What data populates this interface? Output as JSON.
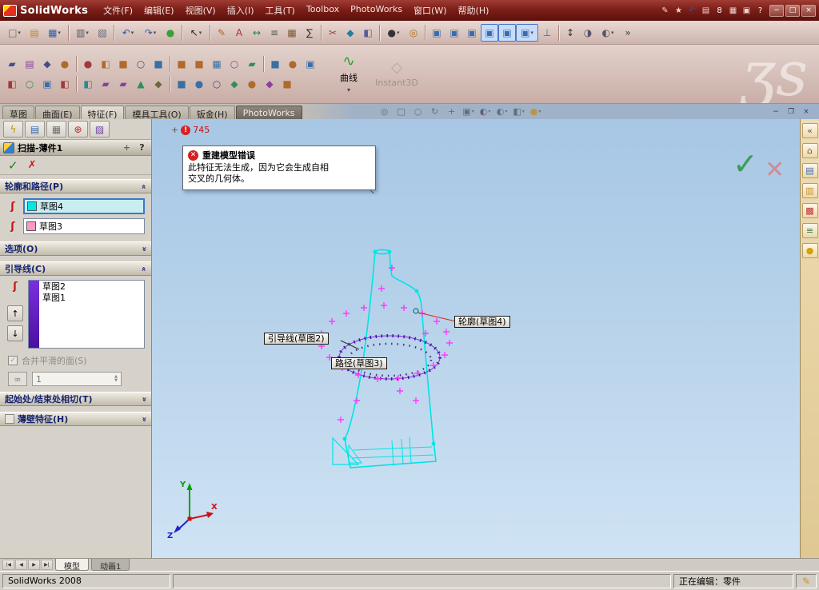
{
  "window": {
    "app_name": "SolidWorks",
    "menus": [
      "文件(F)",
      "编辑(E)",
      "视图(V)",
      "插入(I)",
      "工具(T)",
      "Toolbox",
      "PhotoWorks",
      "窗口(W)",
      "帮助(H)"
    ],
    "title_icons": [
      "pencil",
      "favorites",
      "undo",
      "clipboard",
      "badge-8",
      "grid",
      "windows",
      "help"
    ],
    "window_buttons": [
      "minimize",
      "maximize",
      "close"
    ]
  },
  "brand": {
    "watermark": "ʒs"
  },
  "toolbars": {
    "row1": [
      "new",
      "open",
      "save",
      "|",
      "print",
      "print-preview",
      "|",
      "undo",
      "redo",
      "rebuild",
      "|",
      "select",
      "|",
      "sketch",
      "spell-check",
      "dimension",
      "note",
      "table",
      "equation",
      "|",
      "trim",
      "convert",
      "mirror",
      "|",
      "camera",
      "render",
      "|",
      "front-view",
      "back-view",
      "left-view",
      "right-view",
      "top-view",
      "iso-view",
      "normal-to",
      "|",
      "arrow-updown",
      "section",
      "display-style",
      "more"
    ],
    "row2": [
      "extrude-boss",
      "revolve-boss",
      "swept-boss",
      "lofted-boss",
      "|",
      "extruded-cut",
      "revolved-cut",
      "swept-cut",
      "lofted-cut",
      "hole-wizard",
      "|",
      "fillet",
      "chamfer",
      "shell",
      "rib",
      "draft",
      "|",
      "linear-pattern",
      "circular-pattern",
      "mirror-feature"
    ],
    "row3": [
      "plane",
      "axis",
      "point",
      "coordinate-system",
      "|",
      "helix",
      "spline-curve",
      "project-curve",
      "composite-curve",
      "split-line",
      "|",
      "3d-sketch",
      "freeform",
      "deform",
      "flex",
      "wrap",
      "dome",
      "scale"
    ],
    "curve_label": "曲线",
    "instant3d_label": "Instant3D"
  },
  "command_tabs": [
    {
      "key": "sketch",
      "label": "草图",
      "state": "normal"
    },
    {
      "key": "surfaces",
      "label": "曲面(E)",
      "state": "normal"
    },
    {
      "key": "features",
      "label": "特征(F)",
      "state": "active"
    },
    {
      "key": "mold-tools",
      "label": "模具工具(O)",
      "state": "normal"
    },
    {
      "key": "sheet-metal",
      "label": "钣金(H)",
      "state": "normal"
    },
    {
      "key": "photoworks",
      "label": "PhotoWorks",
      "state": "dark"
    }
  ],
  "view_toolbar": [
    "zoom-to-fit",
    "zoom-area",
    "zoom-in-out",
    "rotate-view",
    "pan",
    "view-orientation",
    "display-style",
    "hide-show",
    "section-view",
    "appearance"
  ],
  "doc_window_buttons": [
    "minimize",
    "restore",
    "close"
  ],
  "panel_tabs": [
    "featuremanager",
    "propertymanager",
    "configurationmanager",
    "dimxpertmanager",
    "displaymanager"
  ],
  "property_manager": {
    "title": "扫描-薄件1",
    "profile_path": {
      "header": "轮廓和路径(P)",
      "profile_value": "草图4",
      "path_value": "草图3"
    },
    "options": {
      "header": "选项(O)"
    },
    "guide_curves": {
      "header": "引导线(C)",
      "items": [
        "草图2",
        "草图1"
      ],
      "merge_checkbox": "合并平滑的面(S)",
      "spinner_value": "1"
    },
    "start_end_tangency": {
      "header": "起始处/结束处相切(T)"
    },
    "thin_feature": {
      "header": "薄壁特征(H)"
    }
  },
  "viewport": {
    "rebuild_badge": {
      "prefix": "+",
      "value": "745"
    },
    "error_tooltip": {
      "title": "重建模型错误",
      "line1": "此特征无法生成，因为它会生成自相",
      "line2": "交叉的几何体。"
    },
    "callouts": {
      "profile": "轮廓(草图4)",
      "guide": "引导线(草图2)",
      "path": "路径(草图3)"
    },
    "triad": {
      "x": "X",
      "y": "Y",
      "z": "Z"
    }
  },
  "task_pane": [
    "collapse-arrows",
    "solidworks-resources",
    "design-library",
    "file-explorer",
    "pdm-vault",
    "search-results",
    "document-help"
  ],
  "bottom_tabs": {
    "nav_icons": [
      "first",
      "previous",
      "next",
      "last"
    ],
    "tabs": [
      {
        "label": "模型",
        "active": true
      },
      {
        "label": "动画1",
        "active": false
      }
    ]
  },
  "status_bar": {
    "left": "SolidWorks 2008",
    "editing": "正在编辑：零件"
  }
}
